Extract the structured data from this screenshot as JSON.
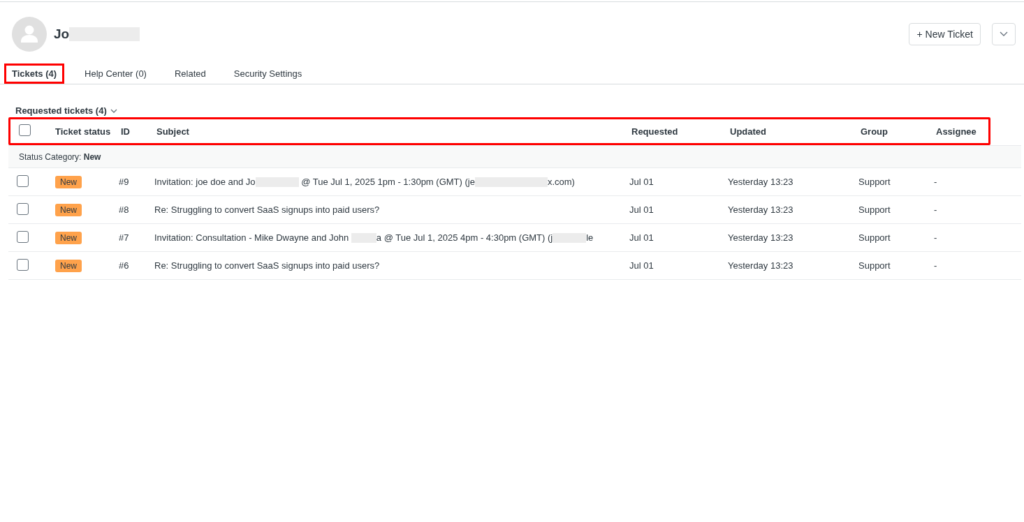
{
  "user": {
    "name_parts": [
      {
        "kind": "text",
        "text": "Jo"
      },
      {
        "kind": "redacted"
      }
    ]
  },
  "actions": {
    "new_ticket": "+ New Ticket"
  },
  "tabs": [
    {
      "label": "Tickets (4)",
      "selected": true,
      "highlighted": true
    },
    {
      "label": "Help Center (0)",
      "selected": false,
      "highlighted": false
    },
    {
      "label": "Related",
      "selected": false,
      "highlighted": false
    },
    {
      "label": "Security Settings",
      "selected": false,
      "highlighted": false
    }
  ],
  "section": {
    "title": "Requested tickets (4)",
    "expanded": true
  },
  "table": {
    "header_highlighted": true,
    "columns": [
      "Ticket status",
      "ID",
      "Subject",
      "Requested",
      "Updated",
      "Group",
      "Assignee"
    ],
    "group": {
      "label": "Status Category:",
      "value": "New"
    },
    "rows": [
      {
        "checked": false,
        "status": "New",
        "id": "#9",
        "subject": [
          {
            "kind": "text",
            "text": "Invitation: joe doe and Jo"
          },
          {
            "kind": "redacted"
          },
          {
            "kind": "text",
            "text": " @ Tue Jul 1, 2025 1pm - 1:30pm (GMT) (je"
          },
          {
            "kind": "redacted"
          },
          {
            "kind": "text",
            "text": "x.com)"
          }
        ],
        "requested": "Jul 01",
        "updated": "Yesterday 13:23",
        "group": "Support",
        "assignee": "-"
      },
      {
        "checked": false,
        "status": "New",
        "id": "#8",
        "subject": [
          {
            "kind": "text",
            "text": "Re: Struggling to convert SaaS signups into paid users?"
          }
        ],
        "requested": "Jul 01",
        "updated": "Yesterday 13:23",
        "group": "Support",
        "assignee": "-"
      },
      {
        "checked": false,
        "status": "New",
        "id": "#7",
        "subject": [
          {
            "kind": "text",
            "text": "Invitation: Consultation - Mike Dwayne and John "
          },
          {
            "kind": "redacted"
          },
          {
            "kind": "text",
            "text": "a @ Tue Jul 1, 2025 4pm - 4:30pm (GMT) (j"
          },
          {
            "kind": "redacted"
          },
          {
            "kind": "text",
            "text": "le"
          }
        ],
        "requested": "Jul 01",
        "updated": "Yesterday 13:23",
        "group": "Support",
        "assignee": "-"
      },
      {
        "checked": false,
        "status": "New",
        "id": "#6",
        "subject": [
          {
            "kind": "text",
            "text": "Re: Struggling to convert SaaS signups into paid users?"
          }
        ],
        "requested": "Jul 01",
        "updated": "Yesterday 13:23",
        "group": "Support",
        "assignee": "-"
      }
    ]
  }
}
